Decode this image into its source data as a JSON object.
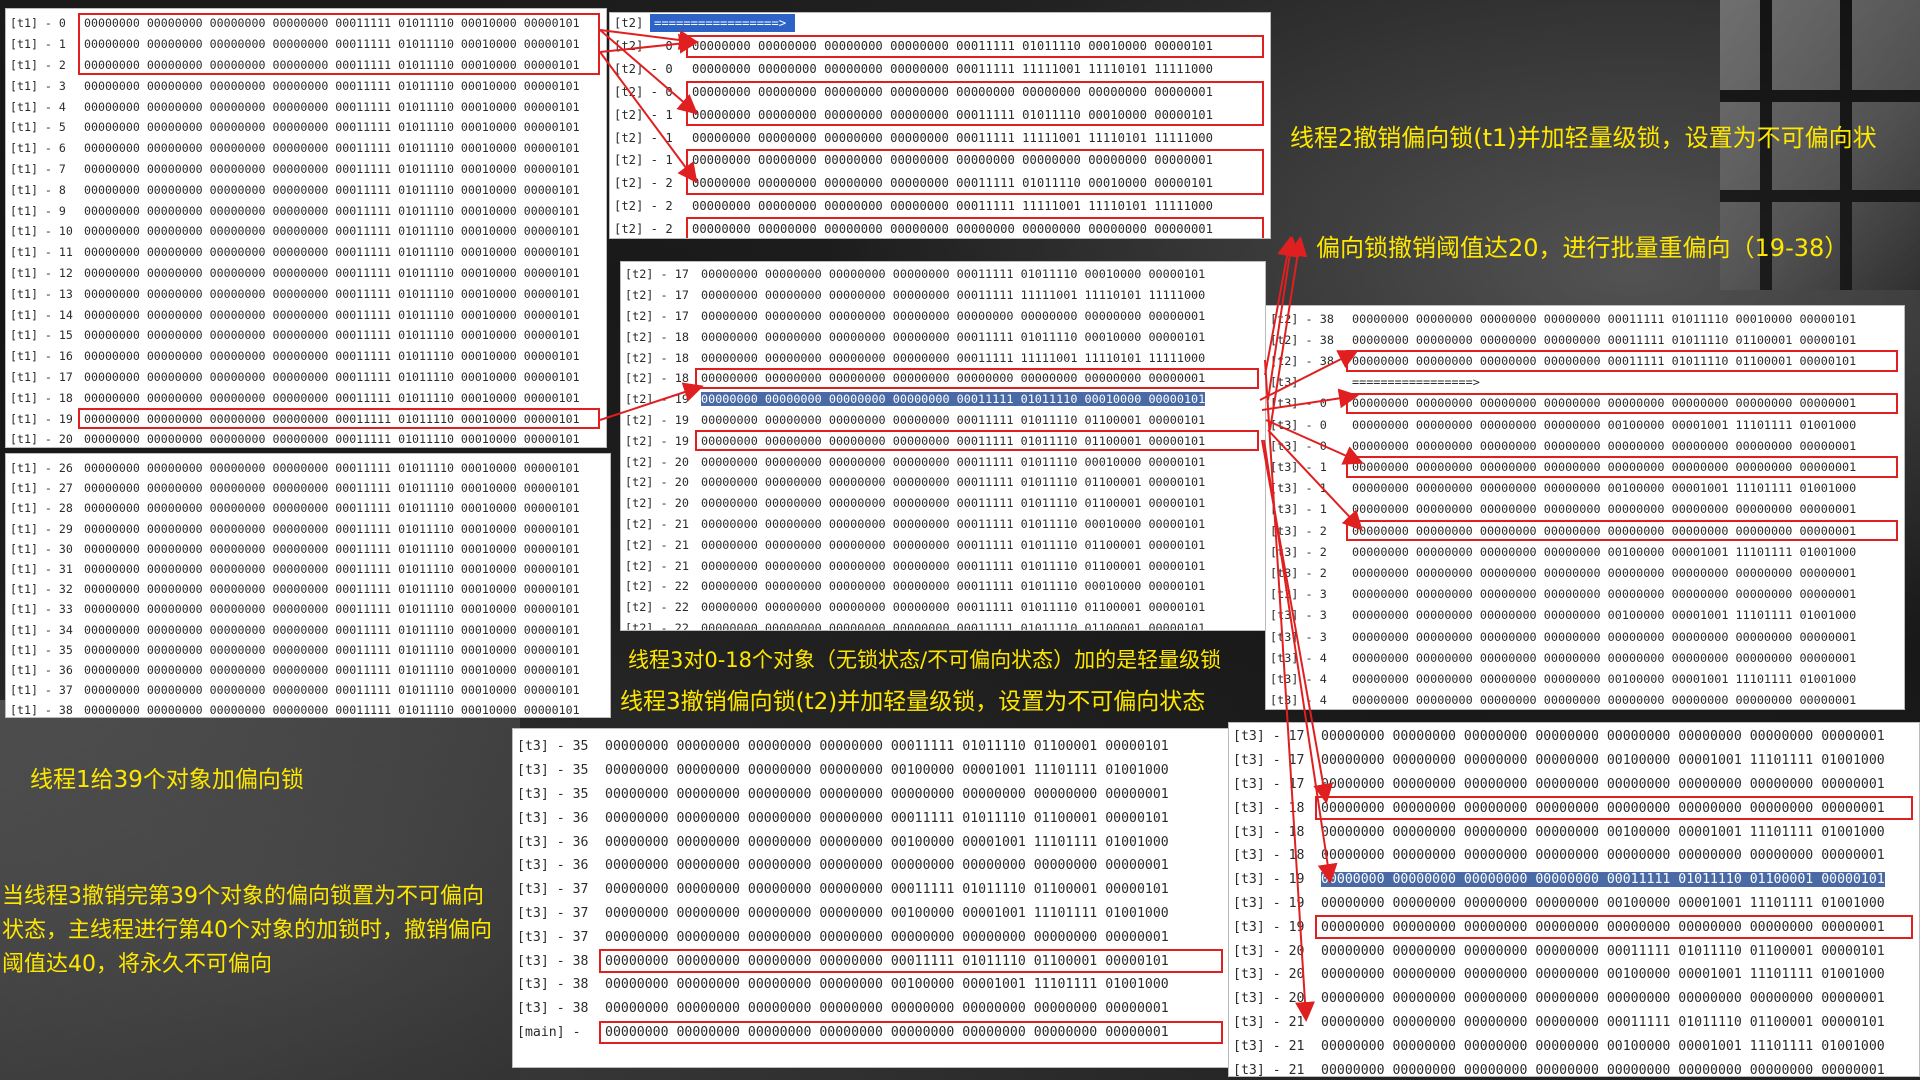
{
  "bits_t1": "00000000 00000000 00000000 00000000 00011111 01011110 00010000 00000101",
  "panels": {
    "t1a": {
      "rows": [
        [
          "[t1] - 0",
          "00000000 00000000 00000000 00000000 00011111 01011110 00010000 00000101"
        ],
        [
          "[t1] - 1",
          "00000000 00000000 00000000 00000000 00011111 01011110 00010000 00000101"
        ],
        [
          "[t1] - 2",
          "00000000 00000000 00000000 00000000 00011111 01011110 00010000 00000101"
        ],
        [
          "[t1] - 3",
          "00000000 00000000 00000000 00000000 00011111 01011110 00010000 00000101"
        ],
        [
          "[t1] - 4",
          "00000000 00000000 00000000 00000000 00011111 01011110 00010000 00000101"
        ],
        [
          "[t1] - 5",
          "00000000 00000000 00000000 00000000 00011111 01011110 00010000 00000101"
        ],
        [
          "[t1] - 6",
          "00000000 00000000 00000000 00000000 00011111 01011110 00010000 00000101"
        ],
        [
          "[t1] - 7",
          "00000000 00000000 00000000 00000000 00011111 01011110 00010000 00000101"
        ],
        [
          "[t1] - 8",
          "00000000 00000000 00000000 00000000 00011111 01011110 00010000 00000101"
        ],
        [
          "[t1] - 9",
          "00000000 00000000 00000000 00000000 00011111 01011110 00010000 00000101"
        ],
        [
          "[t1] - 10",
          "00000000 00000000 00000000 00000000 00011111 01011110 00010000 00000101"
        ],
        [
          "[t1] - 11",
          "00000000 00000000 00000000 00000000 00011111 01011110 00010000 00000101"
        ],
        [
          "[t1] - 12",
          "00000000 00000000 00000000 00000000 00011111 01011110 00010000 00000101"
        ],
        [
          "[t1] - 13",
          "00000000 00000000 00000000 00000000 00011111 01011110 00010000 00000101"
        ],
        [
          "[t1] - 14",
          "00000000 00000000 00000000 00000000 00011111 01011110 00010000 00000101"
        ],
        [
          "[t1] - 15",
          "00000000 00000000 00000000 00000000 00011111 01011110 00010000 00000101"
        ],
        [
          "[t1] - 16",
          "00000000 00000000 00000000 00000000 00011111 01011110 00010000 00000101"
        ],
        [
          "[t1] - 17",
          "00000000 00000000 00000000 00000000 00011111 01011110 00010000 00000101"
        ],
        [
          "[t1] - 18",
          "00000000 00000000 00000000 00000000 00011111 01011110 00010000 00000101"
        ],
        [
          "[t1] - 19",
          "00000000 00000000 00000000 00000000 00011111 01011110 00010000 00000101"
        ],
        [
          "[t1] - 20",
          "00000000 00000000 00000000 00000000 00011111 01011110 00010000 00000101"
        ]
      ]
    },
    "t1b": {
      "rows": [
        [
          "[t1] - 26",
          "00000000 00000000 00000000 00000000 00011111 01011110 00010000 00000101"
        ],
        [
          "[t1] - 27",
          "00000000 00000000 00000000 00000000 00011111 01011110 00010000 00000101"
        ],
        [
          "[t1] - 28",
          "00000000 00000000 00000000 00000000 00011111 01011110 00010000 00000101"
        ],
        [
          "[t1] - 29",
          "00000000 00000000 00000000 00000000 00011111 01011110 00010000 00000101"
        ],
        [
          "[t1] - 30",
          "00000000 00000000 00000000 00000000 00011111 01011110 00010000 00000101"
        ],
        [
          "[t1] - 31",
          "00000000 00000000 00000000 00000000 00011111 01011110 00010000 00000101"
        ],
        [
          "[t1] - 32",
          "00000000 00000000 00000000 00000000 00011111 01011110 00010000 00000101"
        ],
        [
          "[t1] - 33",
          "00000000 00000000 00000000 00000000 00011111 01011110 00010000 00000101"
        ],
        [
          "[t1] - 34",
          "00000000 00000000 00000000 00000000 00011111 01011110 00010000 00000101"
        ],
        [
          "[t1] - 35",
          "00000000 00000000 00000000 00000000 00011111 01011110 00010000 00000101"
        ],
        [
          "[t1] - 36",
          "00000000 00000000 00000000 00000000 00011111 01011110 00010000 00000101"
        ],
        [
          "[t1] - 37",
          "00000000 00000000 00000000 00000000 00011111 01011110 00010000 00000101"
        ],
        [
          "[t1] - 38",
          "00000000 00000000 00000000 00000000 00011111 01011110 00010000 00000101"
        ]
      ]
    },
    "t2a": {
      "header": "[t2]",
      "header_bar": "=================>",
      "rows": [
        [
          "[t2] - 0",
          "00000000 00000000 00000000 00000000 00011111 01011110 00010000 00000101"
        ],
        [
          "[t2] - 0",
          "00000000 00000000 00000000 00000000 00011111 11111001 11110101 11111000"
        ],
        [
          "[t2] - 0",
          "00000000 00000000 00000000 00000000 00000000 00000000 00000000 00000001"
        ],
        [
          "[t2] - 1",
          "00000000 00000000 00000000 00000000 00011111 01011110 00010000 00000101"
        ],
        [
          "[t2] - 1",
          "00000000 00000000 00000000 00000000 00011111 11111001 11110101 11111000"
        ],
        [
          "[t2] - 1",
          "00000000 00000000 00000000 00000000 00000000 00000000 00000000 00000001"
        ],
        [
          "[t2] - 2",
          "00000000 00000000 00000000 00000000 00011111 01011110 00010000 00000101"
        ],
        [
          "[t2] - 2",
          "00000000 00000000 00000000 00000000 00011111 11111001 11110101 11111000"
        ],
        [
          "[t2] - 2",
          "00000000 00000000 00000000 00000000 00000000 00000000 00000000 00000001"
        ]
      ]
    },
    "t2b": {
      "rows": [
        [
          "[t2] - 17",
          "00000000 00000000 00000000 00000000 00011111 01011110 00010000 00000101"
        ],
        [
          "[t2] - 17",
          "00000000 00000000 00000000 00000000 00011111 11111001 11110101 11111000"
        ],
        [
          "[t2] - 17",
          "00000000 00000000 00000000 00000000 00000000 00000000 00000000 00000001"
        ],
        [
          "[t2] - 18",
          "00000000 00000000 00000000 00000000 00011111 01011110 00010000 00000101"
        ],
        [
          "[t2] - 18",
          "00000000 00000000 00000000 00000000 00011111 11111001 11110101 11111000"
        ],
        [
          "[t2] - 18",
          "00000000 00000000 00000000 00000000 00000000 00000000 00000000 00000001"
        ],
        [
          "[t2] - 19",
          "00000000 00000000 00000000 00000000 00011111 01011110 00010000 00000101"
        ],
        [
          "[t2] - 19",
          "00000000 00000000 00000000 00000000 00011111 01011110 01100001 00000101"
        ],
        [
          "[t2] - 19",
          "00000000 00000000 00000000 00000000 00011111 01011110 01100001 00000101"
        ],
        [
          "[t2] - 20",
          "00000000 00000000 00000000 00000000 00011111 01011110 00010000 00000101"
        ],
        [
          "[t2] - 20",
          "00000000 00000000 00000000 00000000 00011111 01011110 01100001 00000101"
        ],
        [
          "[t2] - 20",
          "00000000 00000000 00000000 00000000 00011111 01011110 01100001 00000101"
        ],
        [
          "[t2] - 21",
          "00000000 00000000 00000000 00000000 00011111 01011110 00010000 00000101"
        ],
        [
          "[t2] - 21",
          "00000000 00000000 00000000 00000000 00011111 01011110 01100001 00000101"
        ],
        [
          "[t2] - 21",
          "00000000 00000000 00000000 00000000 00011111 01011110 01100001 00000101"
        ],
        [
          "[t2] - 22",
          "00000000 00000000 00000000 00000000 00011111 01011110 00010000 00000101"
        ],
        [
          "[t2] - 22",
          "00000000 00000000 00000000 00000000 00011111 01011110 01100001 00000101"
        ],
        [
          "[t2] - 22",
          "00000000 00000000 00000000 00000000 00011111 01011110 01100001 00000101"
        ]
      ]
    },
    "t3a": {
      "rows": [
        [
          "[t2] - 38",
          "00000000 00000000 00000000 00000000 00011111 01011110 00010000 00000101"
        ],
        [
          "[t2] - 38",
          "00000000 00000000 00000000 00000000 00011111 01011110 01100001 00000101"
        ],
        [
          "[t2] - 38",
          "00000000 00000000 00000000 00000000 00011111 01011110 01100001 00000101"
        ],
        [
          "[t3]",
          "=================>"
        ],
        [
          "[t3] - 0",
          "00000000 00000000 00000000 00000000 00000000 00000000 00000000 00000001"
        ],
        [
          "[t3] - 0",
          "00000000 00000000 00000000 00000000 00100000 00001001 11101111 01001000"
        ],
        [
          "[t3] - 0",
          "00000000 00000000 00000000 00000000 00000000 00000000 00000000 00000001"
        ],
        [
          "[t3] - 1",
          "00000000 00000000 00000000 00000000 00000000 00000000 00000000 00000001"
        ],
        [
          "[t3] - 1",
          "00000000 00000000 00000000 00000000 00100000 00001001 11101111 01001000"
        ],
        [
          "[t3] - 1",
          "00000000 00000000 00000000 00000000 00000000 00000000 00000000 00000001"
        ],
        [
          "[t3] - 2",
          "00000000 00000000 00000000 00000000 00000000 00000000 00000000 00000001"
        ],
        [
          "[t3] - 2",
          "00000000 00000000 00000000 00000000 00100000 00001001 11101111 01001000"
        ],
        [
          "[t3] - 2",
          "00000000 00000000 00000000 00000000 00000000 00000000 00000000 00000001"
        ],
        [
          "[t3] - 3",
          "00000000 00000000 00000000 00000000 00000000 00000000 00000000 00000001"
        ],
        [
          "[t3] - 3",
          "00000000 00000000 00000000 00000000 00100000 00001001 11101111 01001000"
        ],
        [
          "[t3] - 3",
          "00000000 00000000 00000000 00000000 00000000 00000000 00000000 00000001"
        ],
        [
          "[t3] - 4",
          "00000000 00000000 00000000 00000000 00000000 00000000 00000000 00000001"
        ],
        [
          "[t3] - 4",
          "00000000 00000000 00000000 00000000 00100000 00001001 11101111 01001000"
        ],
        [
          "[t3] - 4",
          "00000000 00000000 00000000 00000000 00000000 00000000 00000000 00000001"
        ]
      ]
    },
    "t3b": {
      "rows": [
        [
          "[t3] - 35",
          "00000000 00000000 00000000 00000000 00011111 01011110 01100001 00000101"
        ],
        [
          "[t3] - 35",
          "00000000 00000000 00000000 00000000 00100000 00001001 11101111 01001000"
        ],
        [
          "[t3] - 35",
          "00000000 00000000 00000000 00000000 00000000 00000000 00000000 00000001"
        ],
        [
          "[t3] - 36",
          "00000000 00000000 00000000 00000000 00011111 01011110 01100001 00000101"
        ],
        [
          "[t3] - 36",
          "00000000 00000000 00000000 00000000 00100000 00001001 11101111 01001000"
        ],
        [
          "[t3] - 36",
          "00000000 00000000 00000000 00000000 00000000 00000000 00000000 00000001"
        ],
        [
          "[t3] - 37",
          "00000000 00000000 00000000 00000000 00011111 01011110 01100001 00000101"
        ],
        [
          "[t3] - 37",
          "00000000 00000000 00000000 00000000 00100000 00001001 11101111 01001000"
        ],
        [
          "[t3] - 37",
          "00000000 00000000 00000000 00000000 00000000 00000000 00000000 00000001"
        ],
        [
          "[t3] - 38",
          "00000000 00000000 00000000 00000000 00011111 01011110 01100001 00000101"
        ],
        [
          "[t3] - 38",
          "00000000 00000000 00000000 00000000 00100000 00001001 11101111 01001000"
        ],
        [
          "[t3] - 38",
          "00000000 00000000 00000000 00000000 00000000 00000000 00000000 00000001"
        ],
        [
          "[main] -",
          "00000000 00000000 00000000 00000000 00000000 00000000 00000000 00000001"
        ]
      ]
    },
    "t3c": {
      "rows": [
        [
          "[t3] - 17",
          "00000000 00000000 00000000 00000000 00000000 00000000 00000000 00000001"
        ],
        [
          "[t3] - 17",
          "00000000 00000000 00000000 00000000 00100000 00001001 11101111 01001000"
        ],
        [
          "[t3] - 17",
          "00000000 00000000 00000000 00000000 00000000 00000000 00000000 00000001"
        ],
        [
          "[t3] - 18",
          "00000000 00000000 00000000 00000000 00000000 00000000 00000000 00000001"
        ],
        [
          "[t3] - 18",
          "00000000 00000000 00000000 00000000 00100000 00001001 11101111 01001000"
        ],
        [
          "[t3] - 18",
          "00000000 00000000 00000000 00000000 00000000 00000000 00000000 00000001"
        ],
        [
          "[t3] - 19",
          "00000000 00000000 00000000 00000000 00011111 01011110 01100001 00000101"
        ],
        [
          "[t3] - 19",
          "00000000 00000000 00000000 00000000 00100000 00001001 11101111 01001000"
        ],
        [
          "[t3] - 19",
          "00000000 00000000 00000000 00000000 00000000 00000000 00000000 00000001"
        ],
        [
          "[t3] - 20",
          "00000000 00000000 00000000 00000000 00011111 01011110 01100001 00000101"
        ],
        [
          "[t3] - 20",
          "00000000 00000000 00000000 00000000 00100000 00001001 11101111 01001000"
        ],
        [
          "[t3] - 20",
          "00000000 00000000 00000000 00000000 00000000 00000000 00000000 00000001"
        ],
        [
          "[t3] - 21",
          "00000000 00000000 00000000 00000000 00011111 01011110 01100001 00000101"
        ],
        [
          "[t3] - 21",
          "00000000 00000000 00000000 00000000 00100000 00001001 11101111 01001000"
        ],
        [
          "[t3] - 21",
          "00000000 00000000 00000000 00000000 00000000 00000000 00000000 00000001"
        ]
      ]
    }
  },
  "captions": {
    "t2_revoke": "线程2撤销偏向锁(t1)并加轻量级锁，设置为不可偏向状",
    "rebias": "偏向锁撤销阈值达20，进行批量重偏向（19-38）",
    "t3_light": "线程3对0-18个对象（无锁状态/不可偏向状态）加的是轻量级锁",
    "t3_revoke": "线程3撤销偏向锁(t2)并加轻量级锁，设置为不可偏向状态",
    "t1_bias": "线程1给39个对象加偏向锁",
    "permanent": "当线程3撤销完第39个对象的偏向锁置为不可偏向状态，主线程进行第40个对象的加锁时，撤销偏向阈值达40，将永久不可偏向"
  },
  "colors": {
    "caption": "#ffe800",
    "highlight": "#e02020",
    "arrow": "#e02020",
    "selection": "#4a6aa5"
  }
}
